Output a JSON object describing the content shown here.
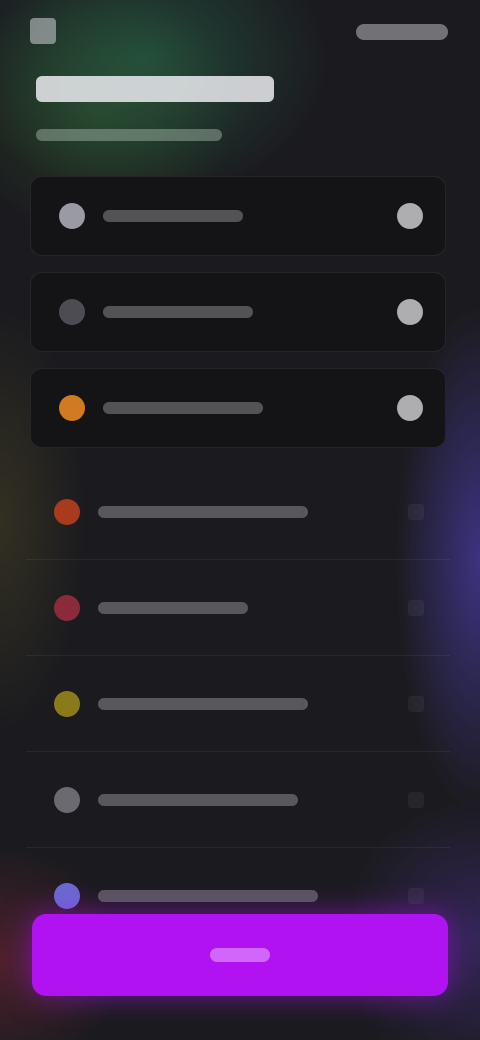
{
  "header": {
    "title": "",
    "subtitle": ""
  },
  "items": [
    {
      "label": "",
      "icon": "gear-icon",
      "color": "#9a9aa2",
      "style": "card",
      "control": "toggle"
    },
    {
      "label": "",
      "icon": "dot-icon",
      "color": "#5a5a60",
      "style": "card",
      "control": "toggle"
    },
    {
      "label": "",
      "icon": "flame-icon",
      "color": "#d07a22",
      "style": "card",
      "control": "toggle"
    },
    {
      "label": "",
      "icon": "fire-icon",
      "color": "#a83a1e",
      "style": "plain",
      "control": "chevron"
    },
    {
      "label": "",
      "icon": "heart-icon",
      "color": "#8a2a3a",
      "style": "plain",
      "control": "chevron"
    },
    {
      "label": "",
      "icon": "star-icon",
      "color": "#8a7a1a",
      "style": "plain",
      "control": "chevron"
    },
    {
      "label": "",
      "icon": "circle-icon",
      "color": "#6a6a70",
      "style": "plain",
      "control": "chevron"
    },
    {
      "label": "",
      "icon": "user-icon",
      "color": "#6a6ad0",
      "style": "plain",
      "control": "chevron"
    }
  ],
  "cta": {
    "label": ""
  },
  "colors": {
    "accent": "#b012f2",
    "background": "#1b1b1f"
  }
}
